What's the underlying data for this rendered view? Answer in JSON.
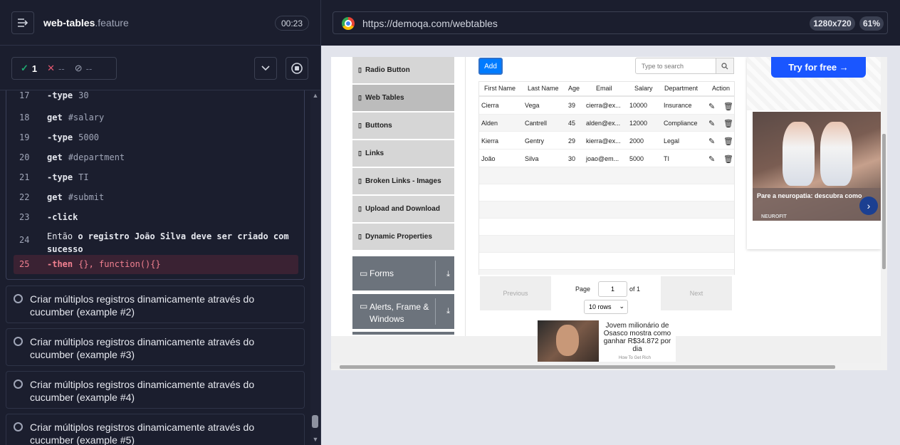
{
  "runner": {
    "file_name": "web-tables",
    "file_ext": ".feature",
    "timer": "00:23",
    "passed": "1",
    "failed": "--",
    "skipped": "--"
  },
  "code_lines": [
    {
      "num": "17",
      "kw": "-type",
      "arg": "30"
    },
    {
      "num": "18",
      "kw": "get",
      "arg": "#salary"
    },
    {
      "num": "19",
      "kw": "-type",
      "arg": "5000"
    },
    {
      "num": "20",
      "kw": "get",
      "arg": "#department"
    },
    {
      "num": "21",
      "kw": "-type",
      "arg": "TI"
    },
    {
      "num": "22",
      "kw": "get",
      "arg": "#submit"
    },
    {
      "num": "23",
      "kw": "-click",
      "arg": ""
    },
    {
      "num": "24",
      "kw": "Então",
      "arg": "o registro João Silva deve ser criado com sucesso"
    },
    {
      "num": "25",
      "kw": "-then",
      "arg": "{}, function(){}"
    }
  ],
  "scenarios": [
    "Criar múltiplos registros dinamicamente através do cucumber (example #2)",
    "Criar múltiplos registros dinamicamente através do cucumber (example #3)",
    "Criar múltiplos registros dinamicamente através do cucumber (example #4)",
    "Criar múltiplos registros dinamicamente através do cucumber (example #5)"
  ],
  "browser": {
    "url": "https://demoqa.com/webtables",
    "resolution": "1280x720",
    "zoom": "61%"
  },
  "sidebar": {
    "items": [
      "Radio Button",
      "Web Tables",
      "Buttons",
      "Links",
      "Broken Links - Images",
      "Upload and Download",
      "Dynamic Properties"
    ],
    "active": "Web Tables",
    "groups": [
      "Forms",
      "Alerts, Frame & Windows"
    ]
  },
  "table": {
    "add_label": "Add",
    "search_placeholder": "Type to search",
    "columns": [
      "First Name",
      "Last Name",
      "Age",
      "Email",
      "Salary",
      "Department",
      "Action"
    ],
    "rows": [
      [
        "Cierra",
        "Vega",
        "39",
        "cierra@ex...",
        "10000",
        "Insurance"
      ],
      [
        "Alden",
        "Cantrell",
        "45",
        "alden@ex...",
        "12000",
        "Compliance"
      ],
      [
        "Kierra",
        "Gentry",
        "29",
        "kierra@ex...",
        "2000",
        "Legal"
      ],
      [
        "João",
        "Silva",
        "30",
        "joao@em...",
        "5000",
        "TI"
      ]
    ],
    "previous": "Previous",
    "next": "Next",
    "page_label": "Page",
    "page_value": "1",
    "page_total": "of 1",
    "rows_select": "10 rows"
  },
  "ads": {
    "try_free": "Try for free →",
    "caption": "Pare a neuropatia: descubra como",
    "source": "NEUROFIT",
    "bottom_text": "Jovem milionário de Osasco mostra como ganhar R$34.872 por dia",
    "bottom_source": "How To Get Rich"
  }
}
